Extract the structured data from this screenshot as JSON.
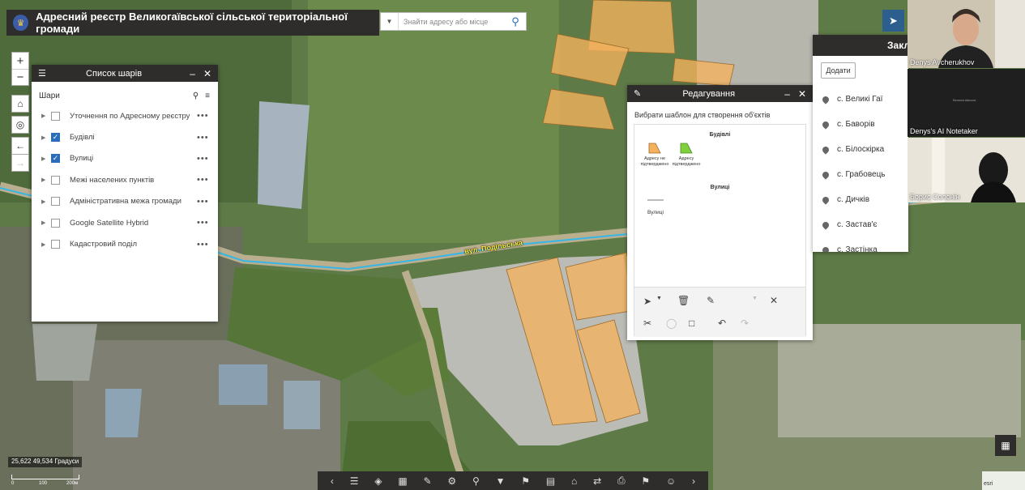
{
  "header": {
    "title": "Адресний реєстр Великогаївської сільської територіальної громади"
  },
  "search": {
    "placeholder": "Знайти адресу або місце"
  },
  "map": {
    "street_label": "вул. Подільська",
    "coordinates": "25,622 49,534 Градуси",
    "scale_labels": [
      "0",
      "100",
      "200м"
    ]
  },
  "layer_list": {
    "title": "Список шарів",
    "section": "Шари",
    "layers": [
      {
        "name": "Уточнення по Адресному реєстру",
        "checked": false
      },
      {
        "name": "Будівлі",
        "checked": true
      },
      {
        "name": "Вулиці",
        "checked": true
      },
      {
        "name": "Межі населених пунктів",
        "checked": false
      },
      {
        "name": "Адміністративна межа громади",
        "checked": false
      },
      {
        "name": "Google Satellite Hybrid",
        "checked": false
      },
      {
        "name": "Кадастровий поділ",
        "checked": false
      }
    ]
  },
  "edit_panel": {
    "title": "Редагування",
    "instruction": "Вибрати шаблон для створення об'єктів",
    "buildings_section": "Будівлі",
    "template_unconfirmed": "Адресу не підтверджено",
    "template_confirmed": "Адресу підтверджено",
    "streets_section": "Вулиці",
    "template_streets": "Вулиці"
  },
  "places_panel": {
    "title": "Закладки",
    "add_button": "Додати",
    "items": [
      "с. Великі Гаї",
      "с. Баворів",
      "с. Білоскірка",
      "с. Грабовець",
      "с. Дичків",
      "с. Застав'є",
      "с. Застінка"
    ]
  },
  "video": {
    "participants": [
      "Denys Avcherukhov",
      "Denys's AI Notetaker",
      "Борис Солонін"
    ],
    "screen_share_text": "Великогаївська"
  },
  "watermark": "esri",
  "colors": {
    "building": "#f5b25e",
    "street": "#35b6e6",
    "accent": "#2a6ebb",
    "header": "#2e2d2b",
    "building_confirmed": "#7fcf3e"
  }
}
